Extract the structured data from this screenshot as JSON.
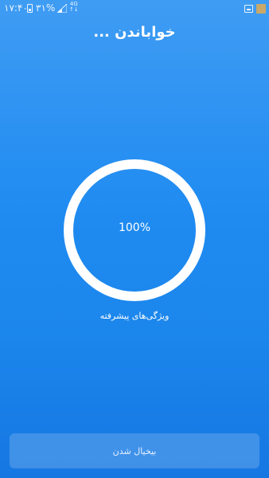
{
  "status_bar": {
    "time": "۱۷:۴۰",
    "battery_percent": "۳۱%",
    "network_type": "4G",
    "network_sub": "↑↓",
    "icons": [
      "battery-icon",
      "signal-icon",
      "notification-icon",
      "app-icon"
    ]
  },
  "header": {
    "title": "خواباندن ..."
  },
  "progress": {
    "value_label": "100%",
    "value": 100,
    "caption": "ویژگی‌های پیشرفته"
  },
  "footer": {
    "cancel_label": "بیخیال شدن"
  },
  "colors": {
    "background_top": "#3f9cf3",
    "background_bottom": "#1677e2",
    "ring": "#ffffff",
    "button_bg": "rgba(255,255,255,0.18)"
  }
}
